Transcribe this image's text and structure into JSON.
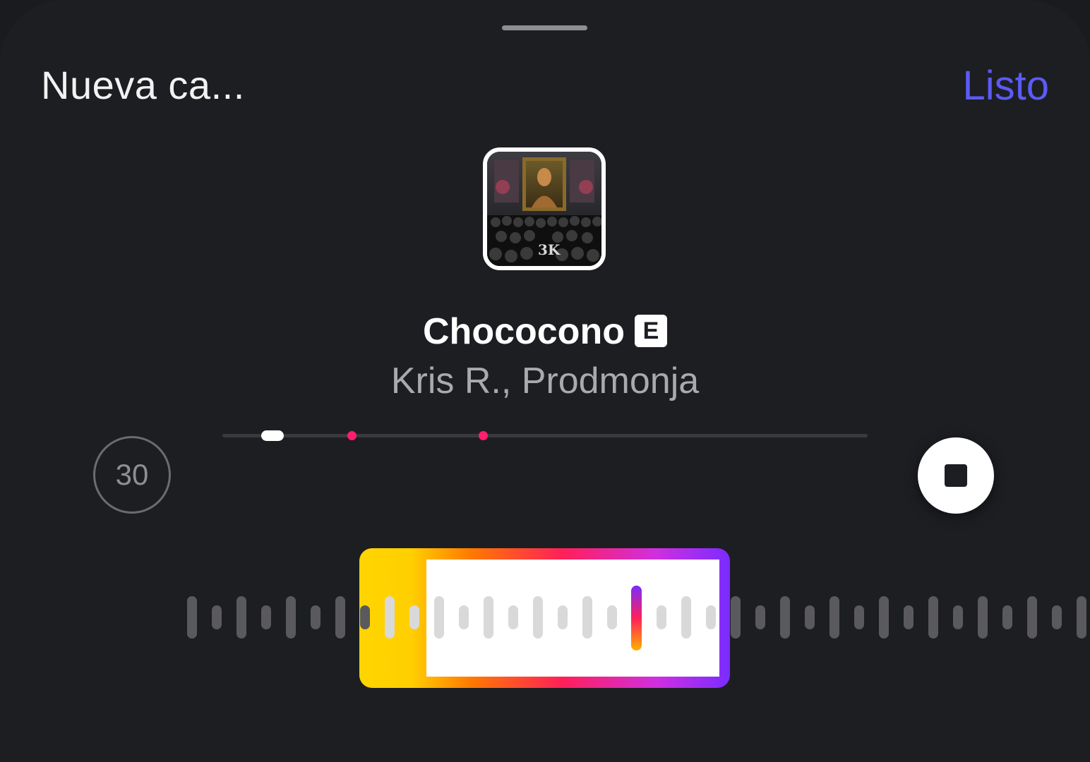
{
  "header": {
    "title": "Nueva ca...",
    "done_label": "Listo"
  },
  "track": {
    "cover_alt": "album-cover",
    "song_title": "Chococono",
    "explicit_badge": "E",
    "artists": "Kris R., Prodmonja"
  },
  "timeline": {
    "playhead_fraction": 0.078,
    "markers_fraction": [
      0.2,
      0.404
    ]
  },
  "controls": {
    "duration_label": "30",
    "stop_icon": "stop-icon"
  },
  "colors": {
    "accent": "#5b5bf5",
    "marker": "#ff1e6b",
    "background": "#1d1e22"
  }
}
